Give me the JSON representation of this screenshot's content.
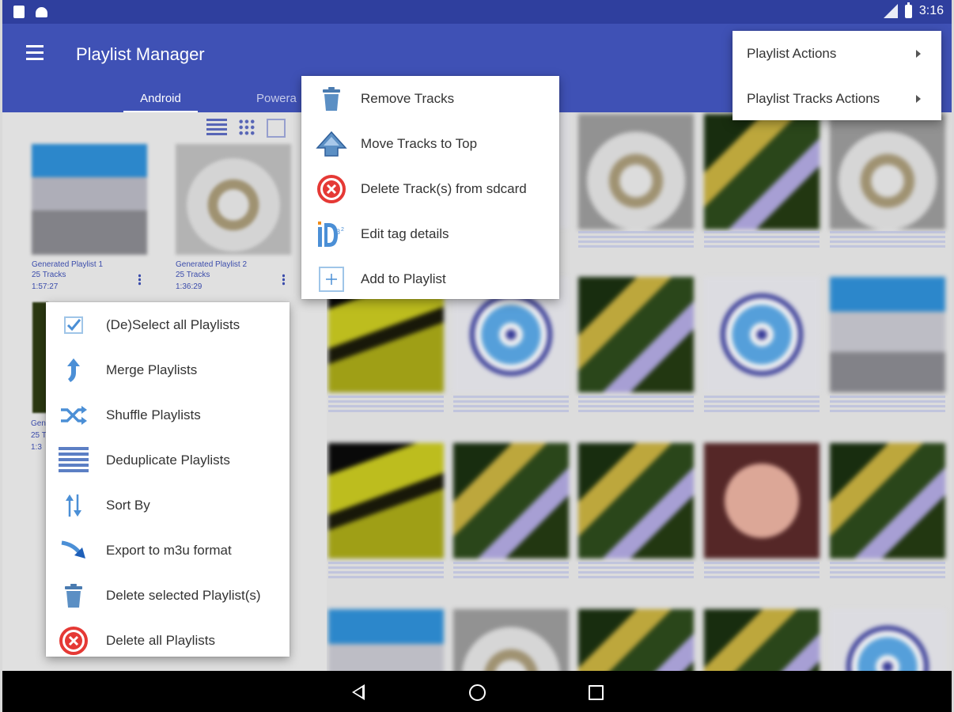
{
  "status_bar": {
    "time": "3:16"
  },
  "app_bar": {
    "title": "Playlist Manager",
    "tabs": [
      {
        "label": "Android",
        "selected": true
      },
      {
        "label": "Powera",
        "selected": false
      }
    ]
  },
  "playlists": [
    {
      "name": "Generated Playlist 1",
      "tracks": "25 Tracks",
      "duration": "1:57:27"
    },
    {
      "name": "Generated Playlist 2",
      "tracks": "25 Tracks",
      "duration": "1:36:29"
    },
    {
      "name": "Gener",
      "tracks": "25 T",
      "duration": "1:3"
    }
  ],
  "playlist_menu": {
    "items": [
      {
        "label": "(De)Select all Playlists",
        "icon": "checkbox-icon"
      },
      {
        "label": "Merge Playlists",
        "icon": "merge-icon"
      },
      {
        "label": "Shuffle Playlists",
        "icon": "shuffle-icon"
      },
      {
        "label": "Deduplicate Playlists",
        "icon": "deduplicate-icon"
      },
      {
        "label": "Sort By",
        "icon": "sort-icon"
      },
      {
        "label": "Export to m3u format",
        "icon": "export-icon"
      },
      {
        "label": "Delete selected Playlist(s)",
        "icon": "trash-icon"
      },
      {
        "label": "Delete all Playlists",
        "icon": "delete-circle-icon"
      }
    ]
  },
  "tracks_menu": {
    "items": [
      {
        "label": "Remove Tracks",
        "icon": "trash-icon"
      },
      {
        "label": "Move Tracks to Top",
        "icon": "move-top-icon"
      },
      {
        "label": "Delete Track(s) from sdcard",
        "icon": "delete-circle-icon"
      },
      {
        "label": "Edit tag details",
        "icon": "id3-tag-icon"
      },
      {
        "label": "Add to Playlist",
        "icon": "add-box-icon"
      }
    ]
  },
  "overflow_menu": {
    "items": [
      {
        "label": "Playlist Actions",
        "has_submenu": true
      },
      {
        "label": "Playlist Tracks Actions",
        "has_submenu": true
      }
    ]
  },
  "colors": {
    "primary": "#3f51b5",
    "primary_dark": "#2f3f9e",
    "icon_blue": "#4b8fd6",
    "delete_red": "#e53935"
  }
}
